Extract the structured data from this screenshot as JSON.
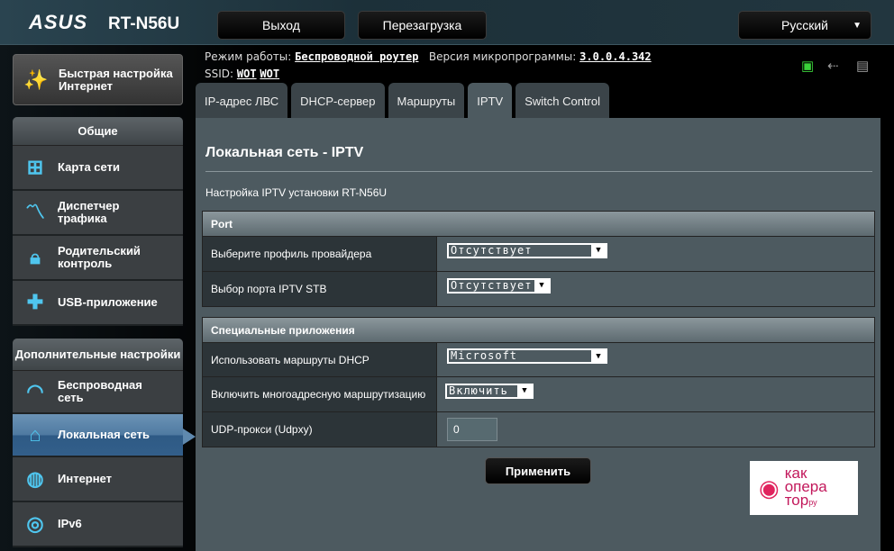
{
  "header": {
    "brand": "ASUS",
    "model": "RT-N56U",
    "logout": "Выход",
    "reboot": "Перезагрузка",
    "language": "Русский"
  },
  "info": {
    "mode_label": "Режим работы:",
    "mode_value": "Беспроводной роутер",
    "fw_label": "Версия микропрограммы:",
    "fw_value": "3.0.0.4.342",
    "ssid_label": "SSID:",
    "ssid1": "WOT",
    "ssid2": "WOT"
  },
  "status_icons": [
    "network-status-icon",
    "usb-icon",
    "printer-icon"
  ],
  "sidebar": {
    "quick": "Быстрая настройка Интернет",
    "general_title": "Общие",
    "general": [
      {
        "label": "Карта сети",
        "icon": "network-map-icon"
      },
      {
        "label": "Диспетчер трафика",
        "icon": "traffic-icon"
      },
      {
        "label": "Родительский контроль",
        "icon": "lock-icon"
      },
      {
        "label": "USB-приложение",
        "icon": "puzzle-icon"
      }
    ],
    "advanced_title": "Дополнительные настройки",
    "advanced": [
      {
        "label": "Беспроводная сеть",
        "icon": "wifi-icon"
      },
      {
        "label": "Локальная сеть",
        "icon": "home-icon",
        "active": true
      },
      {
        "label": "Интернет",
        "icon": "globe-icon"
      },
      {
        "label": "IPv6",
        "icon": "ipv6-icon"
      }
    ]
  },
  "tabs": [
    "IP-адрес ЛВС",
    "DHCP-сервер",
    "Маршруты",
    "IPTV",
    "Switch Control"
  ],
  "active_tab": "IPTV",
  "main": {
    "title": "Локальная сеть - IPTV",
    "subtitle": "Настройка IPTV установки RT-N56U",
    "port": {
      "title": "Port",
      "rows": [
        {
          "label": "Выберите профиль провайдера",
          "value": "Отсутствует"
        },
        {
          "label": "Выбор порта IPTV STB",
          "value": "Отсутствует"
        }
      ]
    },
    "special": {
      "title": "Специальные приложения",
      "rows": [
        {
          "label": "Использовать маршруты DHCP",
          "value": "Microsoft"
        },
        {
          "label": "Включить многоадресную маршрутизацию",
          "value": "Включить"
        },
        {
          "label": "UDP-прокси (Udpxy)",
          "value": "0"
        }
      ]
    },
    "apply": "Применить"
  },
  "watermark": {
    "text": "как опера тор.ру"
  },
  "colors": {
    "accent": "#4fc6ef",
    "active_item": "#4f7aa1",
    "panel": "#4d5a60",
    "status_green": "#3ad13a"
  }
}
